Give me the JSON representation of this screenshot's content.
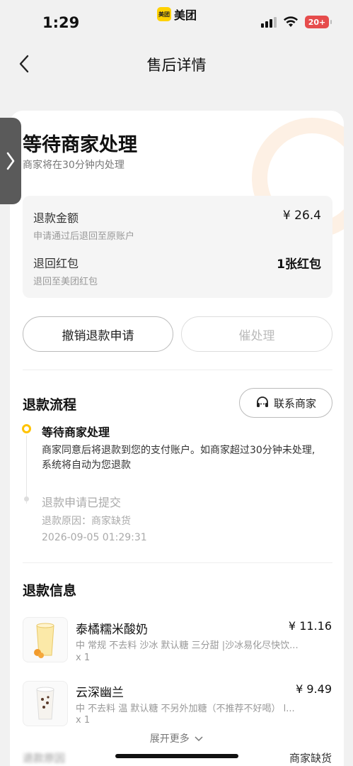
{
  "status_bar": {
    "time": "1:29",
    "app_logo_text": "美团",
    "app_name": "美团",
    "battery": "20+"
  },
  "nav": {
    "title": "售后详情"
  },
  "status": {
    "title": "等待商家处理",
    "subtitle": "商家将在30分钟内处理"
  },
  "refund_summary": {
    "amount_label": "退款金额",
    "amount_value": "¥ 26.4",
    "amount_note": "申请通过后退回至原账户",
    "coupon_label": "退回红包",
    "coupon_value": "1张红包",
    "coupon_note": "退回至美团红包"
  },
  "actions": {
    "cancel_label": "撤销退款申请",
    "urge_label": "催处理"
  },
  "process": {
    "title": "退款流程",
    "contact_label": "联系商家",
    "steps": [
      {
        "title": "等待商家处理",
        "desc": "商家同意后将退款到您的支付账户。如商家超过30分钟未处理,系统将自动为您退款"
      },
      {
        "title": "退款申请已提交",
        "reason": "退款原因：商家缺货",
        "time": "2026-09-05 01:29:31"
      }
    ]
  },
  "refund_info": {
    "title": "退款信息",
    "items": [
      {
        "name": "泰橘糯米酸奶",
        "price": "¥ 11.16",
        "spec": "中 常规 不去料 沙冰 默认糖 三分甜 |沙冰易化尽快饮...",
        "qty": "x 1"
      },
      {
        "name": "云深幽兰",
        "price": "¥ 9.49",
        "spec": "中 不去料 温 默认糖 不另外加糖（不推荐不好喝） l...",
        "qty": "x 1"
      }
    ],
    "expand_label": "展开更多",
    "reason_label": "退款原因",
    "reason_value": "商家缺货"
  }
}
